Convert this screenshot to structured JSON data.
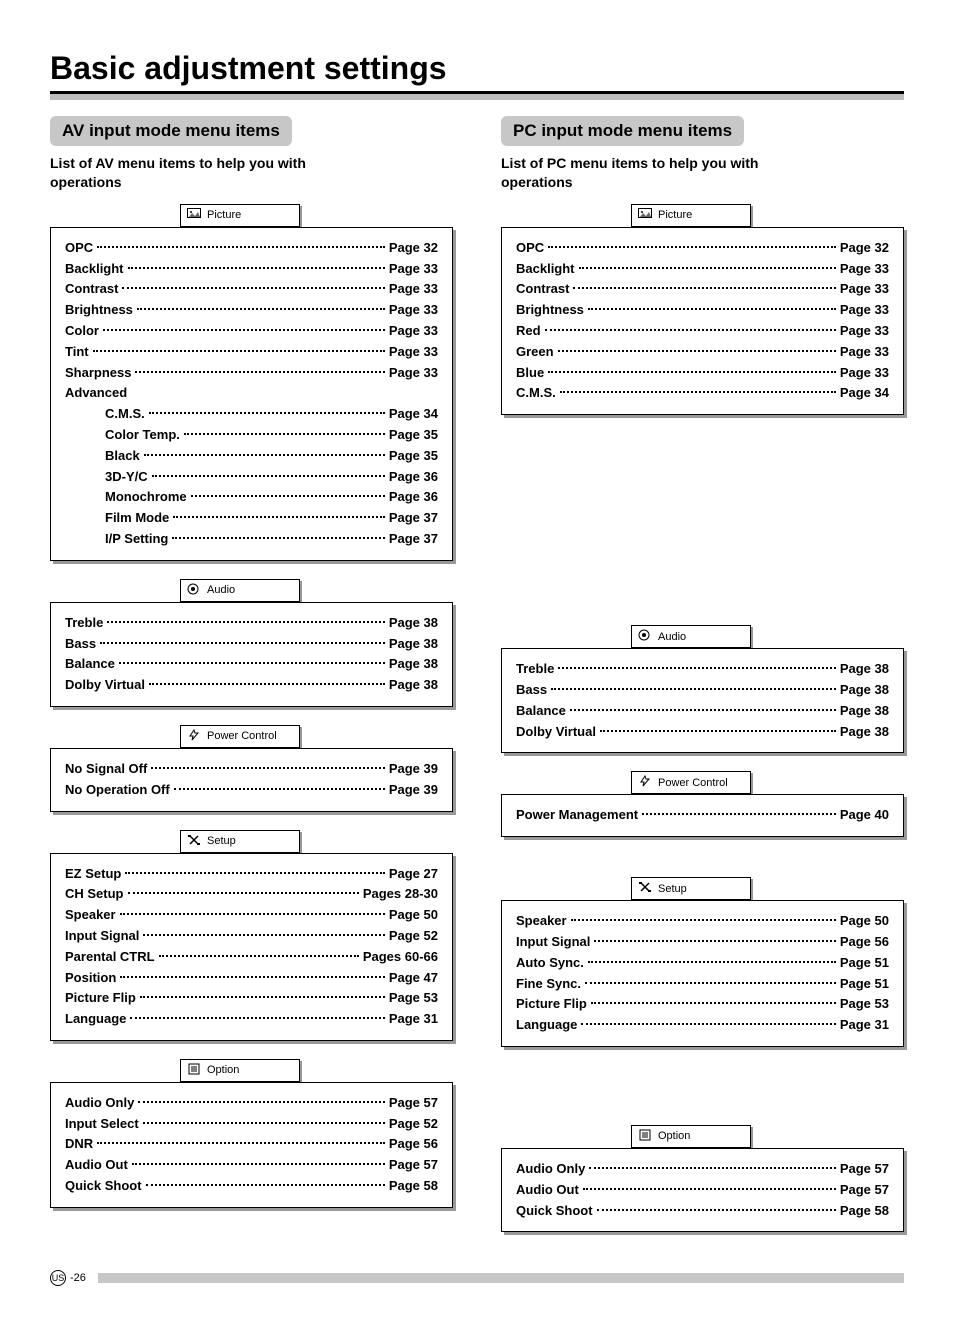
{
  "title": "Basic adjustment settings",
  "footer_region": "US",
  "footer_page": "-26",
  "columns": [
    {
      "header": "AV input mode menu items",
      "sub": "List of AV menu items to help you with operations",
      "groups": [
        {
          "tab": "Picture",
          "icon": "picture",
          "items": [
            {
              "label": "OPC",
              "page": "Page 32"
            },
            {
              "label": "Backlight",
              "page": "Page 33"
            },
            {
              "label": "Contrast",
              "page": "Page 33"
            },
            {
              "label": "Brightness",
              "page": "Page 33"
            },
            {
              "label": "Color",
              "page": "Page 33"
            },
            {
              "label": "Tint",
              "page": "Page 33"
            },
            {
              "label": "Sharpness",
              "page": "Page 33"
            }
          ],
          "subhead": "Advanced",
          "sub_items": [
            {
              "label": "C.M.S.",
              "page": "Page 34"
            },
            {
              "label": "Color Temp.",
              "page": "Page 35"
            },
            {
              "label": "Black",
              "page": "Page 35"
            },
            {
              "label": "3D-Y/C",
              "page": "Page 36"
            },
            {
              "label": "Monochrome",
              "page": "Page 36"
            },
            {
              "label": "Film Mode",
              "page": "Page 37"
            },
            {
              "label": "I/P Setting",
              "page": "Page 37"
            }
          ]
        },
        {
          "tab": "Audio",
          "icon": "audio",
          "items": [
            {
              "label": "Treble",
              "page": "Page 38"
            },
            {
              "label": "Bass",
              "page": "Page 38"
            },
            {
              "label": "Balance",
              "page": "Page 38"
            },
            {
              "label": "Dolby Virtual",
              "page": "Page 38"
            }
          ]
        },
        {
          "tab": "Power Control",
          "icon": "power",
          "items": [
            {
              "label": "No Signal Off",
              "page": "Page 39"
            },
            {
              "label": "No Operation Off",
              "page": "Page 39"
            }
          ]
        },
        {
          "tab": "Setup",
          "icon": "setup",
          "items": [
            {
              "label": "EZ Setup",
              "page": "Page 27"
            },
            {
              "label": "CH Setup",
              "page": "Pages 28-30"
            },
            {
              "label": "Speaker",
              "page": "Page 50"
            },
            {
              "label": "Input Signal",
              "page": "Page 52"
            },
            {
              "label": "Parental CTRL",
              "page": "Pages 60-66"
            },
            {
              "label": "Position",
              "page": "Page 47"
            },
            {
              "label": "Picture Flip",
              "page": "Page 53"
            },
            {
              "label": "Language",
              "page": "Page 31"
            }
          ]
        },
        {
          "tab": "Option",
          "icon": "option",
          "items": [
            {
              "label": "Audio Only",
              "page": "Page 57"
            },
            {
              "label": "Input Select",
              "page": "Page 52"
            },
            {
              "label": "DNR",
              "page": "Page 56"
            },
            {
              "label": "Audio Out",
              "page": "Page 57"
            },
            {
              "label": "Quick Shoot",
              "page": "Page 58"
            }
          ]
        }
      ]
    },
    {
      "header": "PC input mode menu items",
      "sub": "List of PC menu items to help you with operations",
      "groups": [
        {
          "tab": "Picture",
          "icon": "picture",
          "items": [
            {
              "label": "OPC",
              "page": "Page 32"
            },
            {
              "label": "Backlight",
              "page": "Page 33"
            },
            {
              "label": "Contrast",
              "page": "Page 33"
            },
            {
              "label": "Brightness",
              "page": "Page 33"
            },
            {
              "label": "Red",
              "page": "Page 33"
            },
            {
              "label": "Green",
              "page": "Page 33"
            },
            {
              "label": "Blue",
              "page": "Page 33"
            },
            {
              "label": "C.M.S.",
              "page": "Page 34"
            }
          ]
        },
        {
          "tab": "Audio",
          "icon": "audio",
          "items": [
            {
              "label": "Treble",
              "page": "Page 38"
            },
            {
              "label": "Bass",
              "page": "Page 38"
            },
            {
              "label": "Balance",
              "page": "Page 38"
            },
            {
              "label": "Dolby Virtual",
              "page": "Page 38"
            }
          ],
          "spacer_before": 192
        },
        {
          "tab": "Power Control",
          "icon": "power",
          "items": [
            {
              "label": "Power Management",
              "page": "Page 40"
            }
          ]
        },
        {
          "tab": "Setup",
          "icon": "setup",
          "items": [
            {
              "label": "Speaker",
              "page": "Page 50"
            },
            {
              "label": "Input Signal",
              "page": "Page 56"
            },
            {
              "label": "Auto Sync.",
              "page": "Page 51"
            },
            {
              "label": "Fine Sync.",
              "page": "Page 51"
            },
            {
              "label": "Picture Flip",
              "page": "Page 53"
            },
            {
              "label": "Language",
              "page": "Page 31"
            }
          ],
          "spacer_before": 22
        },
        {
          "tab": "Option",
          "icon": "option",
          "items": [
            {
              "label": "Audio Only",
              "page": "Page 57"
            },
            {
              "label": "Audio Out",
              "page": "Page 57"
            },
            {
              "label": "Quick Shoot",
              "page": "Page 58"
            }
          ],
          "spacer_before": 60
        }
      ]
    }
  ]
}
